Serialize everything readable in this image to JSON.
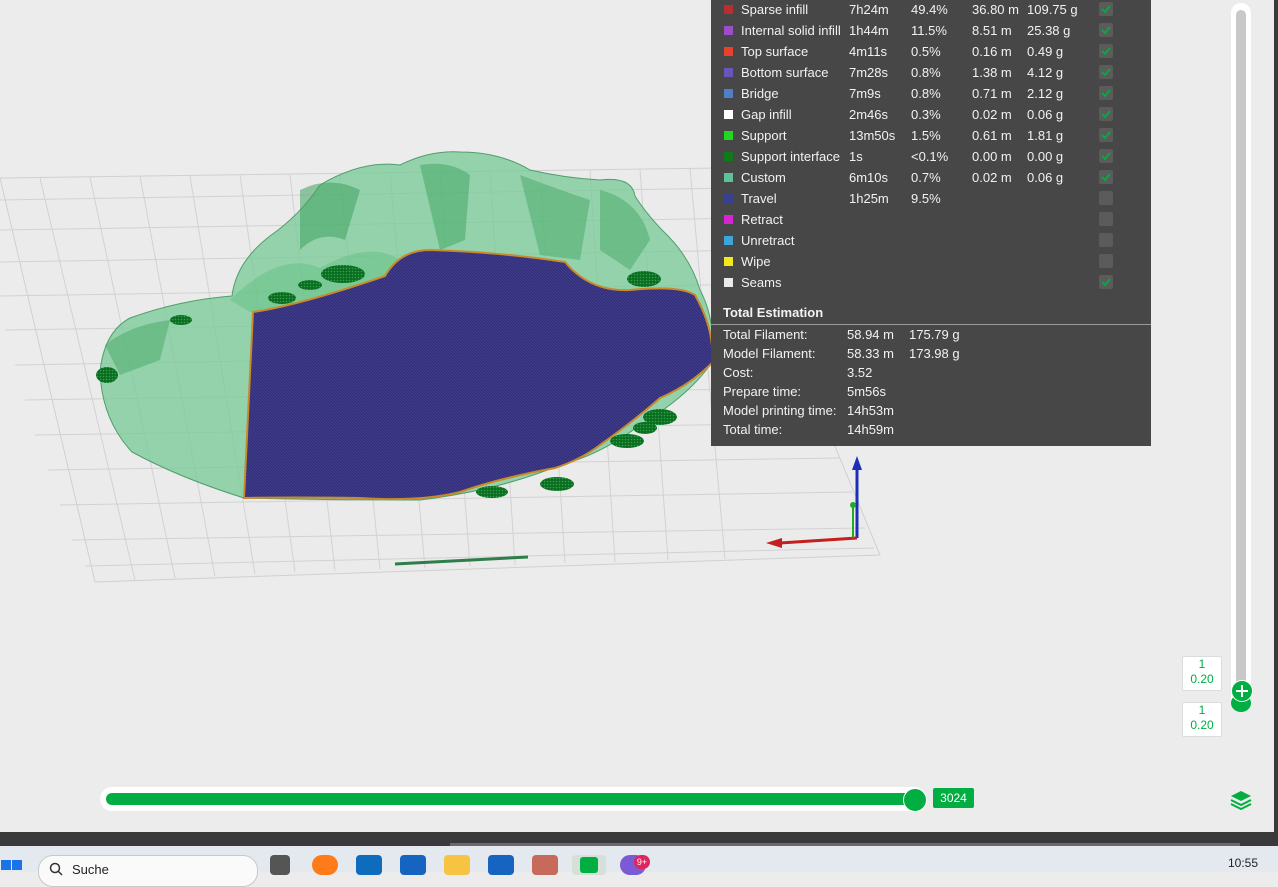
{
  "legend": {
    "rows": [
      {
        "name": "Sparse infill",
        "time": "7h24m",
        "percent": "49.4%",
        "length": "36.80 m",
        "weight": "109.75 g",
        "color": "#b92e2e",
        "checked": true
      },
      {
        "name": "Internal solid infill",
        "time": "1h44m",
        "percent": "11.5%",
        "length": "8.51 m",
        "weight": "25.38 g",
        "color": "#9b4dca",
        "checked": true
      },
      {
        "name": "Top surface",
        "time": "4m11s",
        "percent": "0.5%",
        "length": "0.16 m",
        "weight": "0.49 g",
        "color": "#e8412c",
        "checked": true
      },
      {
        "name": "Bottom surface",
        "time": "7m28s",
        "percent": "0.8%",
        "length": "1.38 m",
        "weight": "4.12 g",
        "color": "#6956b8",
        "checked": true
      },
      {
        "name": "Bridge",
        "time": "7m9s",
        "percent": "0.8%",
        "length": "0.71 m",
        "weight": "2.12 g",
        "color": "#4e7fc8",
        "checked": true
      },
      {
        "name": "Gap infill",
        "time": "2m46s",
        "percent": "0.3%",
        "length": "0.02 m",
        "weight": "0.06 g",
        "color": "#ffffff",
        "checked": true
      },
      {
        "name": "Support",
        "time": "13m50s",
        "percent": "1.5%",
        "length": "0.61 m",
        "weight": "1.81 g",
        "color": "#1ed71e",
        "checked": true
      },
      {
        "name": "Support interface",
        "time": "1s",
        "percent": "<0.1%",
        "length": "0.00 m",
        "weight": "0.00 g",
        "color": "#0e7a1a",
        "checked": true
      },
      {
        "name": "Custom",
        "time": "6m10s",
        "percent": "0.7%",
        "length": "0.02 m",
        "weight": "0.06 g",
        "color": "#5fc19a",
        "checked": true
      },
      {
        "name": "Travel",
        "time": "1h25m",
        "percent": "9.5%",
        "length": "",
        "weight": "",
        "color": "#39408e",
        "checked": false
      },
      {
        "name": "Retract",
        "time": "",
        "percent": "",
        "length": "",
        "weight": "",
        "color": "#d626d1",
        "checked": false
      },
      {
        "name": "Unretract",
        "time": "",
        "percent": "",
        "length": "",
        "weight": "",
        "color": "#3da6d8",
        "checked": false
      },
      {
        "name": "Wipe",
        "time": "",
        "percent": "",
        "length": "",
        "weight": "",
        "color": "#f2e91c",
        "checked": false
      },
      {
        "name": "Seams",
        "time": "",
        "percent": "",
        "length": "",
        "weight": "",
        "color": "#eaeaea",
        "checked": true
      }
    ]
  },
  "total": {
    "title": "Total Estimation",
    "rows": [
      {
        "label": "Total Filament:",
        "v1": "58.94 m",
        "v2": "175.79 g"
      },
      {
        "label": "Model Filament:",
        "v1": "58.33 m",
        "v2": "173.98 g"
      },
      {
        "label": "Cost:",
        "v1": "3.52",
        "v2": ""
      },
      {
        "label": "Prepare time:",
        "v1": "5m56s",
        "v2": ""
      },
      {
        "label": "Model printing time:",
        "v1": "14h53m",
        "v2": ""
      },
      {
        "label": "Total time:",
        "v1": "14h59m",
        "v2": ""
      }
    ]
  },
  "layer_slider": {
    "upper_layer": "1",
    "upper_height": "0.20",
    "lower_layer": "1",
    "lower_height": "0.20"
  },
  "move_slider": {
    "value": "3024",
    "progress": 1.0
  },
  "taskbar": {
    "search_placeholder": "Suche",
    "clock": "10:55",
    "notification_badge": "9+"
  },
  "colors": {
    "accent": "#00ae42",
    "panel": "#474747",
    "print_surface": "#2e2b72",
    "support_green": "#4cc07a"
  }
}
